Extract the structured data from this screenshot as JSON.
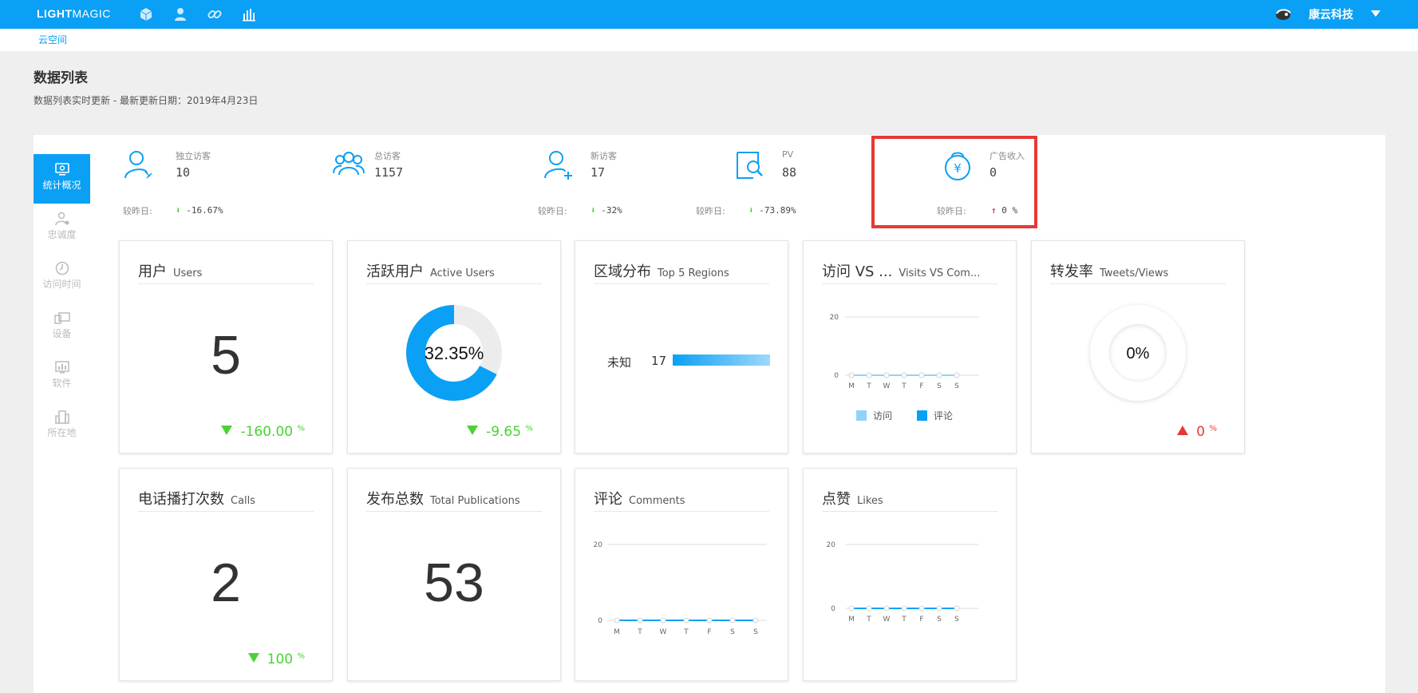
{
  "app": {
    "logo_bold": "LIGHT",
    "logo_thin": "MAGIC",
    "company": "康云科技",
    "nav_icons": [
      "cube-icon",
      "users-icon",
      "link-icon",
      "bar-chart-icon"
    ]
  },
  "breadcrumb": "云空间",
  "page": {
    "title": "数据列表",
    "subtitle": "数据列表实时更新 - 最新更新日期：2019年4月23日"
  },
  "sidebar": {
    "items": [
      {
        "label": "统计概况",
        "icon": "monitor-icon",
        "active": true
      },
      {
        "label": "忠诚度",
        "icon": "user-heart-icon",
        "active": false
      },
      {
        "label": "访问时间",
        "icon": "clock-icon",
        "active": false
      },
      {
        "label": "设备",
        "icon": "devices-icon",
        "active": false
      },
      {
        "label": "软件",
        "icon": "software-icon",
        "active": false
      },
      {
        "label": "所在地",
        "icon": "building-icon",
        "active": false
      }
    ]
  },
  "stats": [
    {
      "name": "独立访客",
      "value": "10",
      "compare": "较昨日:",
      "change": "-16.67%",
      "direction": "down",
      "icon": "visitor-icon"
    },
    {
      "name": "总访客",
      "value": "1157",
      "compare": "",
      "change": "",
      "direction": "none",
      "icon": "group-icon"
    },
    {
      "name": "新访客",
      "value": "17",
      "compare": "较昨日:",
      "change": "-32%",
      "direction": "down",
      "icon": "add-user-icon"
    },
    {
      "name": "PV",
      "value": "88",
      "compare": "较昨日:",
      "change": "-73.89%",
      "direction": "down",
      "icon": "page-search-icon"
    },
    {
      "name": "广告收入",
      "value": "0",
      "compare": "较昨日:",
      "change": "0 %",
      "direction": "up",
      "icon": "money-bag-icon"
    }
  ],
  "cards": {
    "users": {
      "title_cn": "用户",
      "title_en": "Users",
      "value": "5",
      "change": "-160.00",
      "unit": "%"
    },
    "active": {
      "title_cn": "活跃用户",
      "title_en": "Active Users",
      "percent_label": "32.35%",
      "fraction": 0.3235,
      "change": "-9.65",
      "unit": "%"
    },
    "region": {
      "title_cn": "区域分布",
      "title_en": "Top 5 Regions",
      "rows": [
        {
          "name": "未知",
          "value": "17"
        }
      ]
    },
    "visits": {
      "title_cn": "访问 VS ...",
      "title_en": "Visits VS Com...",
      "legend": [
        "访问",
        "评论"
      ]
    },
    "tweets": {
      "title_cn": "转发率",
      "title_en": "Tweets/Views",
      "percent_label": "0%",
      "change": "0",
      "unit": "%"
    },
    "calls": {
      "title_cn": "电话播打次数",
      "title_en": "Calls",
      "value": "2",
      "change": "100",
      "unit": "%"
    },
    "publications": {
      "title_cn": "发布总数",
      "title_en": "Total Publications",
      "value": "53"
    },
    "comments": {
      "title_cn": "评论",
      "title_en": "Comments"
    },
    "likes": {
      "title_cn": "点赞",
      "title_en": "Likes"
    }
  },
  "colors": {
    "accent": "#0aa0f5",
    "visits_series": "#8fd3fb",
    "comments_series": "#0aa0f5",
    "down": "#4cd137",
    "up": "#e53935",
    "highlight": "#e53935"
  },
  "chart_data": [
    {
      "type": "line",
      "x": [
        "M",
        "T",
        "W",
        "T",
        "F",
        "S",
        "S"
      ],
      "series": [
        {
          "name": "访问",
          "values": [
            0,
            0,
            0,
            0,
            0,
            0,
            0
          ]
        },
        {
          "name": "评论",
          "values": [
            0,
            0,
            0,
            0,
            0,
            0,
            0
          ]
        }
      ],
      "yticks": [
        0,
        20
      ],
      "ylim": [
        0,
        20
      ]
    },
    {
      "type": "line",
      "x": [
        "M",
        "T",
        "W",
        "T",
        "F",
        "S",
        "S"
      ],
      "series": [
        {
          "values": [
            0,
            0,
            0,
            0,
            0,
            0,
            0
          ]
        }
      ],
      "yticks": [
        0,
        20
      ],
      "ylim": [
        0,
        20
      ]
    },
    {
      "type": "line",
      "x": [
        "M",
        "T",
        "W",
        "T",
        "F",
        "S",
        "S"
      ],
      "series": [
        {
          "values": [
            0,
            0,
            0,
            0,
            0,
            0,
            0
          ]
        }
      ],
      "yticks": [
        0,
        20
      ],
      "ylim": [
        0,
        20
      ]
    }
  ]
}
